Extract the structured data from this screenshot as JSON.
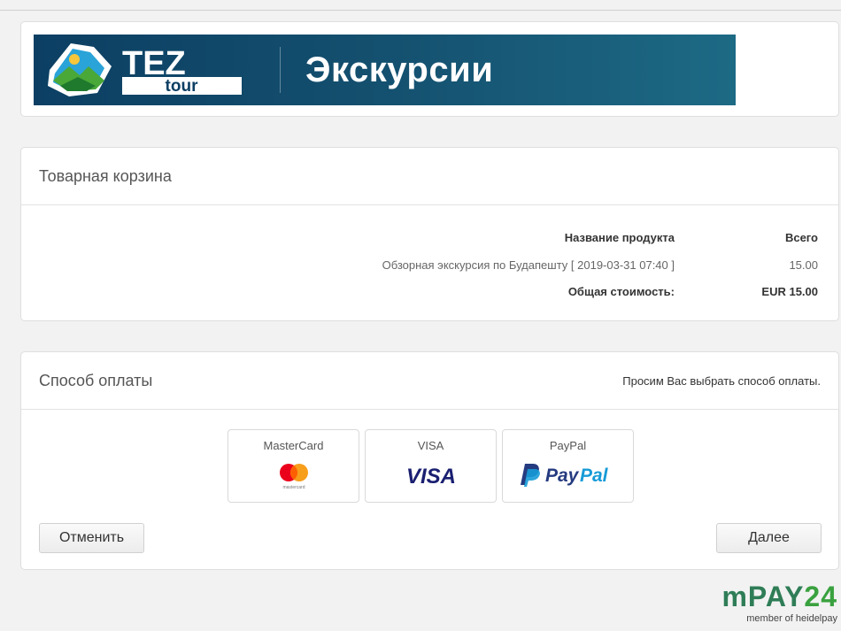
{
  "banner": {
    "logo_top": "TEZ",
    "logo_bottom": "tour",
    "title": "Экскурсии"
  },
  "cart": {
    "title": "Товарная корзина",
    "col_product": "Название продукта",
    "col_total": "Всего",
    "items": [
      {
        "name": "Обзорная экскурсия по Будапешту [ 2019-03-31 07:40 ]",
        "price": "15.00"
      }
    ],
    "total_label": "Общая стоимость:",
    "total_value": "EUR 15.00"
  },
  "payment": {
    "title": "Способ оплаты",
    "hint": "Просим Вас выбрать способ оплаты.",
    "methods": [
      {
        "label": "MasterCard",
        "logo_text": "mastercard"
      },
      {
        "label": "VISA",
        "logo_text": "VISA"
      },
      {
        "label": "PayPal",
        "logo_text_1": "Pay",
        "logo_text_2": "Pal"
      }
    ],
    "cancel_label": "Отменить",
    "next_label": "Далее"
  },
  "footer": {
    "brand_prefix": "mPAY",
    "brand_num": "24",
    "tagline": "member of heidelpay"
  },
  "colors": {
    "banner_bg": "#0c3f63",
    "mastercard_red": "#eb001b",
    "mastercard_orange": "#f79e1b",
    "visa_blue": "#1a1f71",
    "paypal_dark": "#253b80",
    "paypal_light": "#179bd7",
    "mpay_green": "#3aa13f"
  }
}
